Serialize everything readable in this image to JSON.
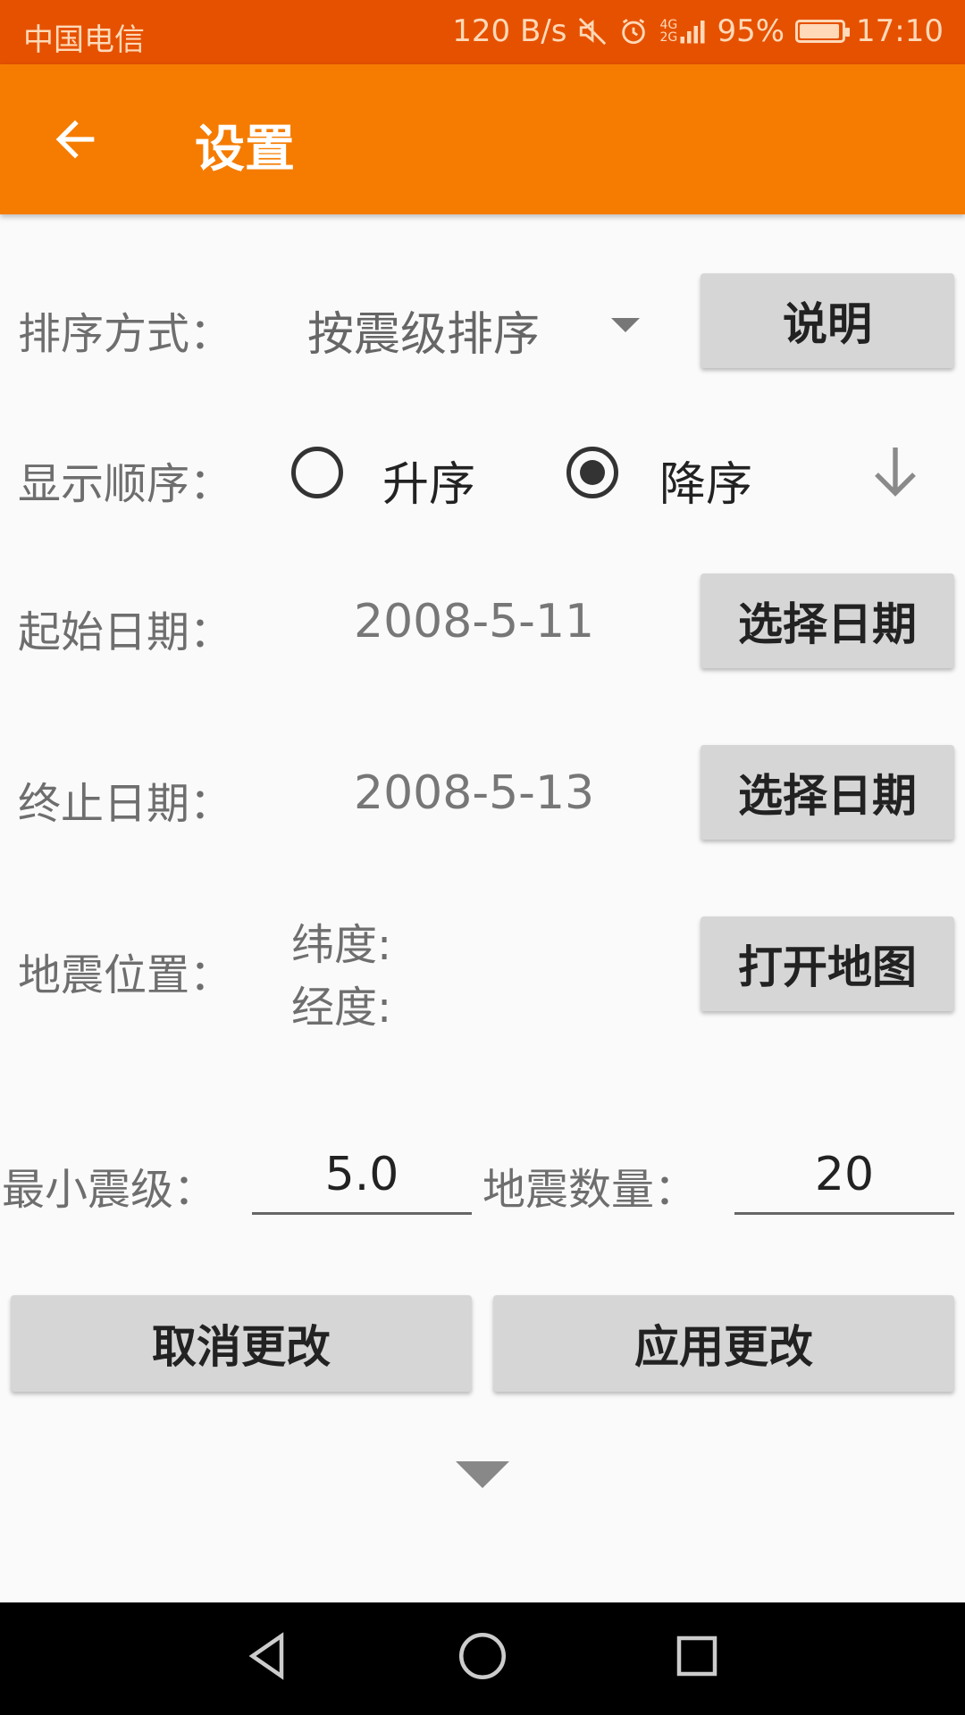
{
  "status_bar": {
    "carrier": "中国电信",
    "net_speed": "120 B/s",
    "network": "4G 2G",
    "battery": "95%",
    "battery_level": 0.95,
    "time": "17:10"
  },
  "app_bar": {
    "title": "设置"
  },
  "sort": {
    "label": "排序方式：",
    "value": "按震级排序",
    "help_button": "说明"
  },
  "order": {
    "label": "显示顺序：",
    "asc_label": "升序",
    "desc_label": "降序",
    "selected": "desc"
  },
  "start_date": {
    "label": "起始日期：",
    "value": "2008-5-11",
    "button": "选择日期"
  },
  "end_date": {
    "label": "终止日期：",
    "value": "2008-5-13",
    "button": "选择日期"
  },
  "location": {
    "label": "地震位置：",
    "lat_label": "纬度:",
    "lng_label": "经度:",
    "button": "打开地图"
  },
  "min_magnitude": {
    "label": "最小震级：",
    "value": "5.0"
  },
  "quake_count": {
    "label": "地震数量：",
    "value": "20"
  },
  "actions": {
    "cancel": "取消更改",
    "apply": "应用更改"
  }
}
